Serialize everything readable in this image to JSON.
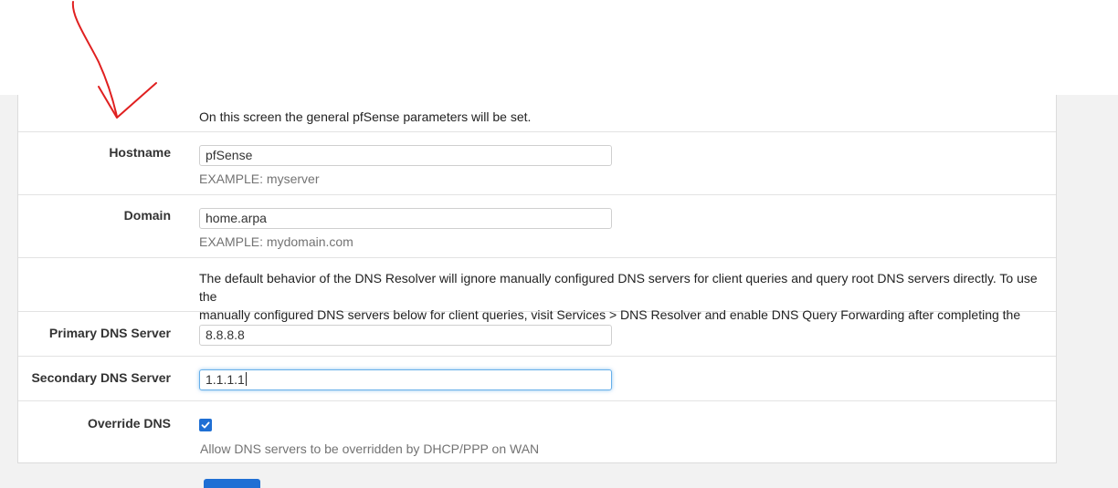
{
  "intro": {
    "text": "On this screen the general pfSense parameters will be set."
  },
  "hostname": {
    "label": "Hostname",
    "value": "pfSense",
    "help": "EXAMPLE: myserver"
  },
  "domain": {
    "label": "Domain",
    "value": "home.arpa",
    "help": "EXAMPLE: mydomain.com"
  },
  "dns_note": {
    "line1": "The default behavior of the DNS Resolver will ignore manually configured DNS servers for client queries and query root DNS servers directly. To use the",
    "line2": "manually configured DNS servers below for client queries, visit Services > DNS Resolver and enable DNS Query Forwarding after completing the wizard."
  },
  "primary_dns": {
    "label": "Primary DNS Server",
    "value": "8.8.8.8"
  },
  "secondary_dns": {
    "label": "Secondary DNS Server",
    "value": "1.1.1.1"
  },
  "override_dns": {
    "label": "Override DNS",
    "checked": true,
    "help": "Allow DNS servers to be overridden by DHCP/PPP on WAN"
  },
  "colors": {
    "accent": "#1f6fd4",
    "annotation": "#e02020",
    "focus": "#66afe9"
  },
  "icons": {
    "checkbox": "check-icon",
    "annotation": "red-arrow-icon"
  }
}
